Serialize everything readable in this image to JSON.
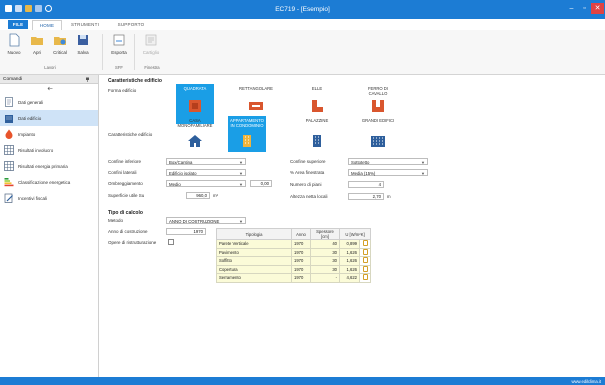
{
  "window": {
    "title": "EC719 - [Esempio]"
  },
  "ribbon_tabs": [
    "FILE",
    "HOME",
    "STRUMENTI",
    "SUPPORTO"
  ],
  "ribbon": {
    "buttons": [
      {
        "label": "Nuovo",
        "icon": "new-document-icon"
      },
      {
        "label": "Apri",
        "icon": "open-folder-icon"
      },
      {
        "label": "Critical",
        "icon": "critical-folder-icon"
      },
      {
        "label": "Salva",
        "icon": "save-disk-icon"
      },
      {
        "label": "Esporta",
        "icon": "export-icon"
      },
      {
        "label": "Cartiglio",
        "icon": "form-icon"
      }
    ],
    "group_labels": {
      "file": "Lavori",
      "sff": "SFF",
      "finestra": "Finestra"
    }
  },
  "left_panel": {
    "title": "Comandi",
    "pin_icon": "pin-icon",
    "back_icon": "back-arrow-icon",
    "items": [
      {
        "label": "Dati generali",
        "icon": "document-icon"
      },
      {
        "label": "Dati edificio",
        "icon": "building-icon"
      },
      {
        "label": "Impianto",
        "icon": "flame-icon"
      },
      {
        "label": "Risultati involucro",
        "icon": "grid-icon"
      },
      {
        "label": "Risultati energia primaria",
        "icon": "grid-icon"
      },
      {
        "label": "Classificazione energetica",
        "icon": "energy-class-icon"
      },
      {
        "label": "Incentivi fiscali",
        "icon": "edit-icon"
      }
    ]
  },
  "building": {
    "section_title": "Caratteristiche edificio",
    "forma_label": "Forma edificio",
    "caratteristiche_label": "Caratteristiche edificio",
    "shapes": [
      {
        "label": "QUADRATA",
        "selected": true
      },
      {
        "label": "RETTANGOLARE",
        "selected": false
      },
      {
        "label": "ELLE",
        "selected": false
      },
      {
        "label": "FERRO DI CAVALLO",
        "selected": false
      }
    ],
    "types": [
      {
        "label": "CASA MONOFAMILIARE",
        "selected": false
      },
      {
        "label": "APPARTAMENTO IN CONDOMINIO",
        "selected": true
      },
      {
        "label": "PALAZZINE",
        "selected": false
      },
      {
        "label": "GRANDI EDIFICI",
        "selected": false
      }
    ]
  },
  "fields": {
    "confine_inferiore": {
      "label": "Confine inferiore",
      "value": "Box/Cantina"
    },
    "confini_laterali": {
      "label": "Confini laterali",
      "value": "Edificio isolato"
    },
    "ombreggiamento": {
      "label": "Ombreggiamento",
      "value": "Medio",
      "extra": "0,00"
    },
    "superficie_utile": {
      "label": "Superficie utile Su",
      "value": "960,0",
      "unit": "m²"
    },
    "confine_superiore": {
      "label": "Confine superiore",
      "value": "Sottotetto"
    },
    "area_finestrata": {
      "label": "% Area finestrata",
      "value": "Media (15%)"
    },
    "numero_piani": {
      "label": "Numero di piani",
      "value": "4"
    },
    "altezza_locali": {
      "label": "Altezza netta locali",
      "value": "2,70",
      "unit": "m"
    }
  },
  "calc": {
    "section_title": "Tipo di calcolo",
    "metodo_label": "Metodo",
    "metodo_value": "ANNO DI COSTRUZIONE",
    "anno_label": "Anno di costruzione",
    "anno_value": "1970",
    "opere_label": "Opere di ristrutturazione"
  },
  "table": {
    "headers": [
      "Tipologia",
      "Anno",
      "Spessore [cm]",
      "U [W/m²K]"
    ],
    "rows": [
      [
        "Parete Verticale",
        "1970",
        "40",
        "0,899"
      ],
      [
        "Pavimento",
        "1970",
        "30",
        "1,626"
      ],
      [
        "Soffitto",
        "1970",
        "30",
        "1,626"
      ],
      [
        "Copertura",
        "1970",
        "30",
        "1,626"
      ],
      [
        "Serramento",
        "1970",
        "-",
        "4,622"
      ]
    ]
  },
  "status": {
    "right_text": "www.edilclima.it"
  },
  "colors": {
    "accent": "#1c7cd4",
    "selected_shape": "#1a9ee6",
    "table_fill": "#fbfbd8"
  }
}
